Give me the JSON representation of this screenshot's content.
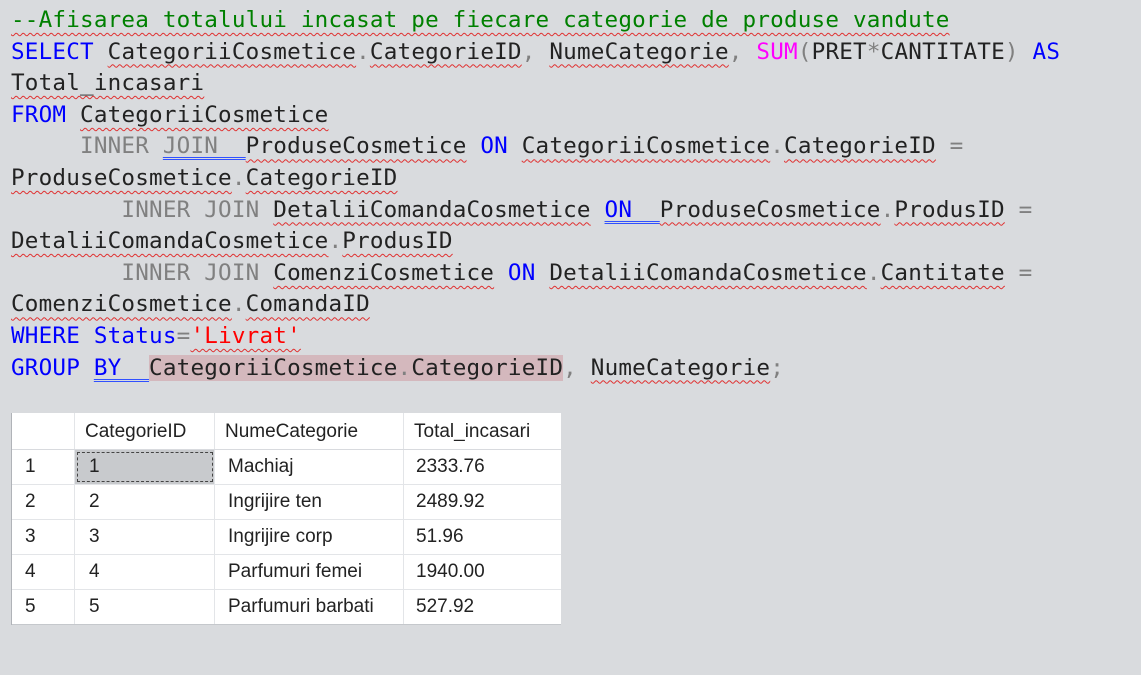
{
  "editor": {
    "lines": [
      [
        {
          "t": "--Afisarea totalului incasat pe fiecare categorie de produse vandute",
          "c": "cm",
          "sq": true
        }
      ],
      [
        {
          "t": "SELECT",
          "c": "kw"
        },
        {
          "t": " "
        },
        {
          "t": "CategoriiCosmetice",
          "sq": true
        },
        {
          "t": ".",
          "c": "op"
        },
        {
          "t": "CategorieID",
          "sq": true
        },
        {
          "t": ", ",
          "c": "op"
        },
        {
          "t": "NumeCategorie",
          "sq": true
        },
        {
          "t": ", ",
          "c": "op"
        },
        {
          "t": "SUM",
          "c": "fn"
        },
        {
          "t": "(",
          "c": "op"
        },
        {
          "t": "PRET"
        },
        {
          "t": "*",
          "c": "op"
        },
        {
          "t": "CANTITATE"
        },
        {
          "t": ")",
          "c": "op"
        },
        {
          "t": " "
        },
        {
          "t": "AS",
          "c": "kw"
        }
      ],
      [
        {
          "t": "Total_incasari",
          "sq": true
        }
      ],
      [
        {
          "t": "FROM",
          "c": "kw"
        },
        {
          "t": " "
        },
        {
          "t": "CategoriiCosmetice",
          "sq": true
        }
      ],
      [
        {
          "t": "     "
        },
        {
          "t": "INNER",
          "c": "op"
        },
        {
          "t": " "
        },
        {
          "t": "JOIN  ",
          "c": "op",
          "dbl": true
        },
        {
          "t": "ProduseCosmetice",
          "sq": true
        },
        {
          "t": " "
        },
        {
          "t": "ON",
          "c": "kw"
        },
        {
          "t": " "
        },
        {
          "t": "CategoriiCosmetice",
          "sq": true
        },
        {
          "t": ".",
          "c": "op"
        },
        {
          "t": "CategorieID",
          "sq": true
        },
        {
          "t": " "
        },
        {
          "t": "=",
          "c": "op"
        }
      ],
      [
        {
          "t": "ProduseCosmetice",
          "sq": true
        },
        {
          "t": ".",
          "c": "op"
        },
        {
          "t": "CategorieID",
          "sq": true
        }
      ],
      [
        {
          "t": "        "
        },
        {
          "t": "INNER JOIN",
          "c": "op"
        },
        {
          "t": " "
        },
        {
          "t": "DetaliiComandaCosmetice",
          "sq": true
        },
        {
          "t": " "
        },
        {
          "t": "ON  ",
          "c": "kw",
          "dbl": true
        },
        {
          "t": "ProduseCosmetice",
          "sq": true
        },
        {
          "t": ".",
          "c": "op"
        },
        {
          "t": "ProdusID",
          "sq": true
        },
        {
          "t": " "
        },
        {
          "t": "=",
          "c": "op"
        }
      ],
      [
        {
          "t": "DetaliiComandaCosmetice",
          "sq": true
        },
        {
          "t": ".",
          "c": "op"
        },
        {
          "t": "ProdusID",
          "sq": true
        }
      ],
      [
        {
          "t": "        "
        },
        {
          "t": "INNER JOIN",
          "c": "op"
        },
        {
          "t": " "
        },
        {
          "t": "ComenziCosmetice",
          "sq": true
        },
        {
          "t": " "
        },
        {
          "t": "ON",
          "c": "kw"
        },
        {
          "t": " "
        },
        {
          "t": "DetaliiComandaCosmetice",
          "sq": true
        },
        {
          "t": ".",
          "c": "op"
        },
        {
          "t": "Cantitate",
          "sq": true
        },
        {
          "t": " "
        },
        {
          "t": "=",
          "c": "op"
        }
      ],
      [
        {
          "t": "ComenziCosmetice",
          "sq": true
        },
        {
          "t": ".",
          "c": "op"
        },
        {
          "t": "ComandaID",
          "sq": true
        }
      ],
      [
        {
          "t": "WHERE",
          "c": "kw"
        },
        {
          "t": " "
        },
        {
          "t": "Status",
          "c": "kw"
        },
        {
          "t": "=",
          "c": "op"
        },
        {
          "t": "'Livrat'",
          "c": "str",
          "sq": true
        }
      ],
      [
        {
          "t": "GROUP",
          "c": "kw"
        },
        {
          "t": " "
        },
        {
          "t": "BY  ",
          "c": "kw",
          "dbl": true
        },
        {
          "t": "CategoriiCosmetice",
          "hl": true
        },
        {
          "t": ".",
          "c": "op",
          "hl": true
        },
        {
          "t": "CategorieID",
          "hl": true
        },
        {
          "t": ", ",
          "c": "op"
        },
        {
          "t": "NumeCategorie",
          "sq": true
        },
        {
          "t": ";",
          "c": "op"
        }
      ]
    ]
  },
  "results": {
    "columns": [
      "",
      "CategorieID",
      "NumeCategorie",
      "Total_incasari"
    ],
    "rows": [
      [
        "1",
        "1",
        "Machiaj",
        "2333.76"
      ],
      [
        "2",
        "2",
        "Ingrijire ten",
        "2489.92"
      ],
      [
        "3",
        "3",
        "Ingrijire corp",
        "51.96"
      ],
      [
        "4",
        "4",
        "Parfumuri femei",
        "1940.00"
      ],
      [
        "5",
        "5",
        "Parfumuri barbati",
        "527.92"
      ]
    ]
  }
}
